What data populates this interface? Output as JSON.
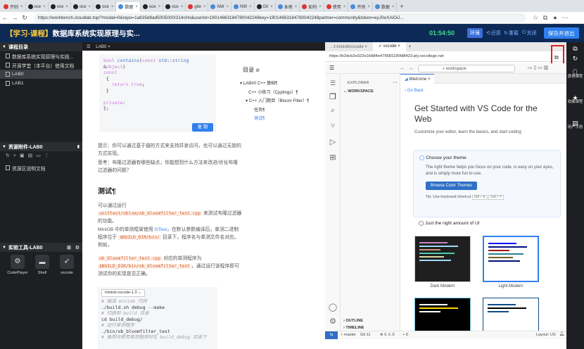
{
  "browser": {
    "tabs": [
      {
        "label": "开则",
        "icon": "red"
      },
      {
        "label": "oce",
        "icon": "gh"
      },
      {
        "label": "oce",
        "icon": "gh"
      },
      {
        "label": "oce",
        "icon": "gh"
      },
      {
        "label": "oce",
        "icon": "gh"
      },
      {
        "label": "数据",
        "icon": "blue",
        "active": true
      },
      {
        "label": "oce",
        "icon": "gh"
      },
      {
        "label": "oce",
        "icon": "gh"
      },
      {
        "label": "gite",
        "icon": "red"
      },
      {
        "label": "NW",
        "icon": "blue"
      },
      {
        "label": "NW",
        "icon": "blue"
      },
      {
        "label": "Git",
        "icon": "gh"
      },
      {
        "label": "本地",
        "icon": "blue"
      },
      {
        "label": "如何",
        "icon": "red"
      },
      {
        "label": "使用",
        "icon": "red"
      },
      {
        "label": "开则",
        "icon": "blue"
      },
      {
        "label": "数据",
        "icon": "blue"
      }
    ],
    "url": "https://workbench.cloudlab.top/?modal=0&repo=1a635d8ad5005000/314cHo&userId=19014663184780042248key=19014663184780042248partner=community&token=eyJ0eXAiOiJ..."
  },
  "app": {
    "title_bracket": "【学习-课程】",
    "title": "数据库系统实现原理与实...",
    "timer": "01:54:50",
    "btn_env": "环境",
    "btn_reset": "还原",
    "btn_restart": "重载",
    "btn_close": "关闭",
    "btn_save": "保存并退出"
  },
  "left": {
    "course_dir_title": "课程目录",
    "course_items": [
      "数据库系统实现原理与实践...",
      "开源学堂（本平台）使用文档",
      "LAB0",
      "LAB1"
    ],
    "resources_title": "资源附件-LAB0",
    "resource_items": [
      "资源区说明文档"
    ],
    "tools_title": "实验工具-LAB0",
    "tools": [
      {
        "label": "CodePlayer",
        "icon": "gear-icon"
      },
      {
        "label": "Shell",
        "icon": "terminal-icon"
      },
      {
        "label": "vscode",
        "icon": "rocket-icon"
      }
    ]
  },
  "doc": {
    "tab": "LAB0",
    "code_lines": [
      "bool contains(const std::string &object)",
      "const",
      "{",
      "  return true;",
      "}",
      "",
      "private:",
      "};"
    ],
    "copy_btn": "复 制",
    "toc_title": "目录",
    "toc": [
      {
        "label": "LAB#0 C++ 基础¶",
        "level": 0
      },
      {
        "label": "C++ 小练习（Cpplings）¶",
        "level": 1
      },
      {
        "label": "C++ 入门题目（Bloom Filter）¶",
        "level": 1
      },
      {
        "label": "任务¶",
        "level": 2
      },
      {
        "label": "测试¶",
        "level": 2
      }
    ],
    "hint1": "提示：你可以通过基于链的方式来支持并发访问，也可以通过无锁的方式实现。",
    "hint2": "思考：布隆过滤器有哪些缺点，你能想到什么方法来改进/优化布隆过滤器的问题？",
    "heading": "测试¶",
    "p1a": "可以通过运行",
    "p1code": "unittest/oblsm/ob_bloomfilter_test.cpp",
    "p1b": "来测试布隆过滤器的功能。",
    "p2a": "MiniOB 中的单测框架使用",
    "p2link": "GTest",
    "p2b": "，在默认参数编译后，单测二进制程序位于",
    "p2code": "$BUILD_DIR/bin/",
    "p2c": "目录下，程序名与单测文件名对应。例如，",
    "p3code1": "ob_bloomfilter_test.cpp",
    "p3a": "对应的单测程序为",
    "p3code2": "$BUILD_DIR/bin/ob_bloomfilter_test",
    "p3b": "，通过运行该程序即可测试你的实现是否正确。",
    "select_value": "miniob-vscode-1.0",
    "code2": [
      "# 编译 miniob 代码",
      "./build.sh debug --make",
      "# 切换到 build 目录",
      "cd build_debug/",
      "# 运行单测程序",
      "./bin/ob_bloomfilter_test",
      "# 推荐你使用单测程序时在 build_debug 目录下"
    ]
  },
  "vs": {
    "outer_tabs": [
      "..:t:miniob/vscode",
      "vscode"
    ],
    "url": "https://b2dcb2e022e1b984e475681195fd8423.ply.oscollege.net",
    "search": "workspace",
    "explorer_title": "EXPLORER",
    "workspace": "WORKSPACE",
    "welcome_tab": "Welcome",
    "go_back": "Go Back",
    "get_started": "Get Started with VS Code for the Web",
    "subtitle": "Customize your editor, learn the basics, and start coding",
    "choose_theme": "Choose your theme",
    "theme_desc": "The right theme helps you focus on your code, is easy on your eyes, and is simply more fun to use.",
    "browse_btn": "Browse Color Themes",
    "tip": "Tip: Use keyboard shortcut",
    "tip_k1": "Ctrl + K",
    "tip_k2": "Ctrl + T",
    "just_right": "Just the right amount of UI",
    "dark_modern": "Dark Modern",
    "light_modern": "Light Modern",
    "outline": "OUTLINE",
    "timeline": "TIMELINE",
    "status": {
      "branch": "master",
      "git": "Git 11",
      "problems": "0 ⚠ 0",
      "ports": "0",
      "layout": "Layout: US"
    }
  },
  "rightbar": {
    "items": [
      "刷新",
      "课程",
      "课程",
      "问卷"
    ],
    "labels": [
      "",
      "邀请课程",
      "收藏课程",
      "用户手册"
    ]
  }
}
